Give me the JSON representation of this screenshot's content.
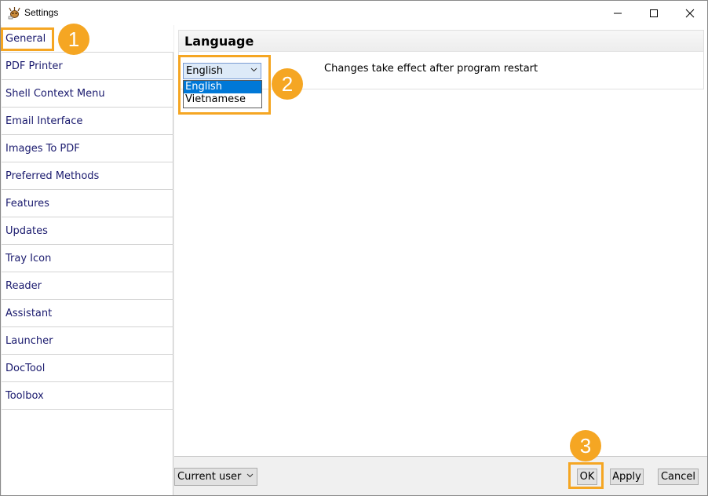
{
  "window": {
    "title": "Settings"
  },
  "sidebar": {
    "items": [
      {
        "label": "General"
      },
      {
        "label": "PDF Printer"
      },
      {
        "label": "Shell Context Menu"
      },
      {
        "label": "Email Interface"
      },
      {
        "label": "Images To PDF"
      },
      {
        "label": "Preferred Methods"
      },
      {
        "label": "Features"
      },
      {
        "label": "Updates"
      },
      {
        "label": "Tray Icon"
      },
      {
        "label": "Reader"
      },
      {
        "label": "Assistant"
      },
      {
        "label": "Launcher"
      },
      {
        "label": "DocTool"
      },
      {
        "label": "Toolbox"
      }
    ],
    "selected": "General"
  },
  "language": {
    "title": "Language",
    "selected": "English",
    "options": [
      "English",
      "Vietnamese"
    ],
    "note": "Changes take effect after program restart"
  },
  "footer": {
    "scope_selected": "Current user",
    "ok_label": "OK",
    "apply_label": "Apply",
    "cancel_label": "Cancel"
  },
  "callouts": {
    "one": "1",
    "two": "2",
    "three": "3"
  },
  "colors": {
    "callout": "#f5a623",
    "link_text": "#1a1a6e",
    "selection": "#0078d7"
  }
}
